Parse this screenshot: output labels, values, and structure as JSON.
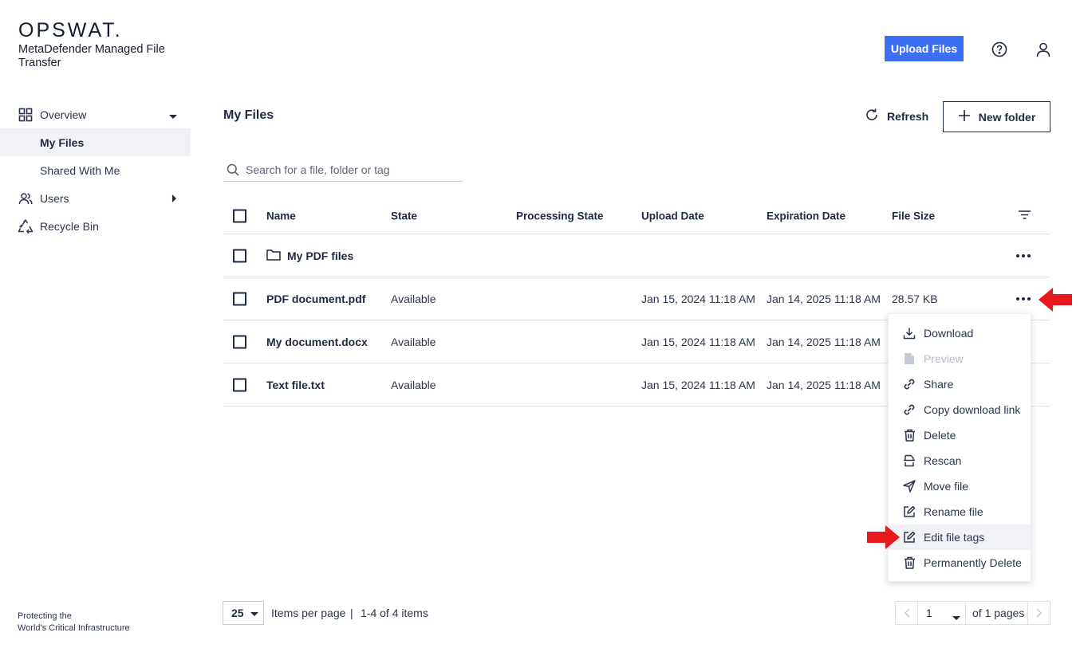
{
  "brand": {
    "logo": "OPSWAT.",
    "product": "MetaDefender Managed File Transfer",
    "tagline_line1": "Protecting the",
    "tagline_line2": "World's Critical Infrastructure"
  },
  "sidebar": {
    "items": [
      {
        "label": "Overview"
      },
      {
        "label": "My Files"
      },
      {
        "label": "Shared With Me"
      },
      {
        "label": "Users"
      },
      {
        "label": "Recycle Bin"
      }
    ]
  },
  "header": {
    "upload_label": "Upload Files"
  },
  "main": {
    "title": "My Files",
    "refresh_label": "Refresh",
    "new_folder_label": "New folder",
    "search_placeholder": "Search for a file, folder or tag"
  },
  "table": {
    "columns": [
      "Name",
      "State",
      "Processing State",
      "Upload Date",
      "Expiration Date",
      "File Size"
    ],
    "rows": [
      {
        "name": "My PDF files",
        "state": "",
        "processing": "",
        "upload": "",
        "expiration": "",
        "size": ""
      },
      {
        "name": "PDF document.pdf",
        "state": "Available",
        "processing": "",
        "upload": "Jan 15, 2024 11:18 AM",
        "expiration": "Jan 14, 2025 11:18 AM",
        "size": "28.57 KB"
      },
      {
        "name": "My document.docx",
        "state": "Available",
        "processing": "",
        "upload": "Jan 15, 2024 11:18 AM",
        "expiration": "Jan 14, 2025 11:18 AM",
        "size": ""
      },
      {
        "name": "Text file.txt",
        "state": "Available",
        "processing": "",
        "upload": "Jan 15, 2024 11:18 AM",
        "expiration": "Jan 14, 2025 11:18 AM",
        "size": ""
      }
    ]
  },
  "context_menu": {
    "items": [
      {
        "label": "Download",
        "icon": "download-icon"
      },
      {
        "label": "Preview",
        "icon": "preview-icon"
      },
      {
        "label": "Share",
        "icon": "link-icon"
      },
      {
        "label": "Copy download link",
        "icon": "link-icon"
      },
      {
        "label": "Delete",
        "icon": "trash-icon"
      },
      {
        "label": "Rescan",
        "icon": "rescan-icon"
      },
      {
        "label": "Move file",
        "icon": "send-icon"
      },
      {
        "label": "Rename file",
        "icon": "edit-icon"
      },
      {
        "label": "Edit file tags",
        "icon": "edit-icon"
      },
      {
        "label": "Permanently Delete",
        "icon": "trash-icon"
      }
    ]
  },
  "pagination": {
    "per_page": "25",
    "per_page_label": "Items per page",
    "separator": "|",
    "range": "1-4 of 4 items",
    "page": "1",
    "total": "of 1 pages"
  },
  "colors": {
    "primary": "#3d6ff5",
    "text": "#1e2a44",
    "annotation_arrow": "#e8191d",
    "active_bg": "#f1f2f5"
  }
}
